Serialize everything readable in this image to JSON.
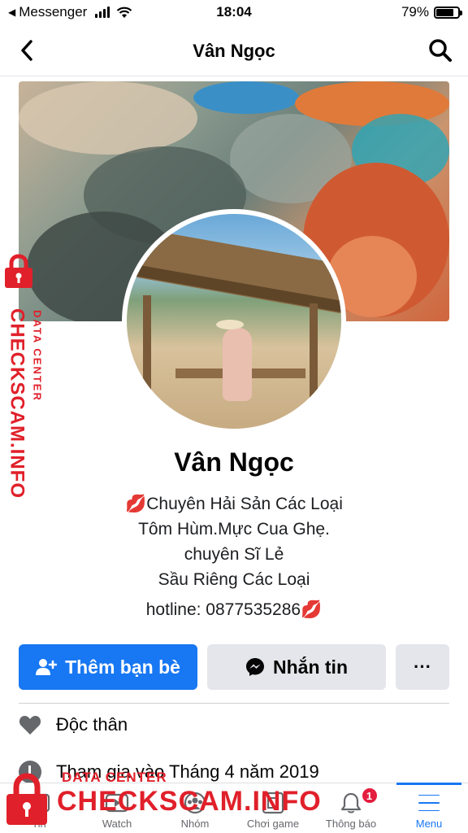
{
  "status_bar": {
    "back_app": "Messenger",
    "time": "18:04",
    "battery": "79%",
    "battery_level": 0.79
  },
  "nav": {
    "title": "Vân Ngọc",
    "back_icon": "chevron-left-icon",
    "search_icon": "search-icon"
  },
  "profile": {
    "name": "Vân Ngọc",
    "bio": [
      "💋Chuyên Hải Sản Các Loại",
      "Tôm Hùm.Mực Cua Ghẹ.",
      "chuyên Sĩ Lẻ",
      "Sầu Riêng Các Loại"
    ],
    "hotline": "hotline: 0877535286💋"
  },
  "actions": {
    "add_friend": "Thêm bạn bè",
    "message": "Nhắn tin",
    "more": "···"
  },
  "info": {
    "relationship": "Độc thân",
    "joined": "Tham gia vào Tháng 4 năm 2019"
  },
  "tabs": [
    {
      "label": "Tin",
      "icon": "news-icon"
    },
    {
      "label": "Watch",
      "icon": "watch-icon"
    },
    {
      "label": "Nhóm",
      "icon": "groups-icon"
    },
    {
      "label": "Chơi game",
      "icon": "gaming-icon"
    },
    {
      "label": "Thông báo",
      "icon": "bell-icon",
      "badge": "1"
    },
    {
      "label": "Menu",
      "icon": "menu-icon"
    }
  ],
  "watermark": {
    "side_main": "CHECKSCAM.INFO",
    "side_sub": "DATA CENTER",
    "bottom_sub": "DATA CENTER",
    "bottom_main": "CHECKSCAM.INFO"
  },
  "colors": {
    "accent": "#1877f2",
    "watermark": "#e0202a",
    "badge": "#e41e3f"
  }
}
